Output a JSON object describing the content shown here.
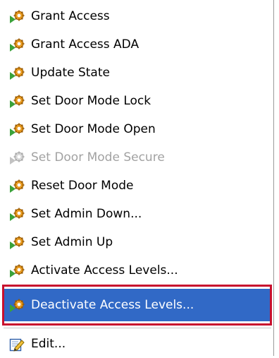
{
  "menu": {
    "items": [
      {
        "label": "Grant Access",
        "state": "normal",
        "icon": "gear-play-icon"
      },
      {
        "label": "Grant Access ADA",
        "state": "normal",
        "icon": "gear-play-icon"
      },
      {
        "label": "Update State",
        "state": "normal",
        "icon": "gear-play-icon"
      },
      {
        "label": "Set Door Mode Lock",
        "state": "normal",
        "icon": "gear-play-icon"
      },
      {
        "label": "Set Door Mode Open",
        "state": "normal",
        "icon": "gear-play-icon"
      },
      {
        "label": "Set Door Mode Secure",
        "state": "disabled",
        "icon": "gear-play-icon"
      },
      {
        "label": "Reset Door Mode",
        "state": "normal",
        "icon": "gear-play-icon"
      },
      {
        "label": "Set Admin Down...",
        "state": "normal",
        "icon": "gear-play-icon"
      },
      {
        "label": "Set Admin Up",
        "state": "normal",
        "icon": "gear-play-icon"
      },
      {
        "label": "Activate Access Levels...",
        "state": "normal",
        "icon": "gear-play-icon"
      },
      {
        "label": "Deactivate Access Levels...",
        "state": "selected",
        "icon": "gear-play-icon"
      },
      {
        "label": "Edit...",
        "state": "normal",
        "icon": "edit-pencil-icon"
      }
    ]
  },
  "colors": {
    "selection": "#3169c6",
    "highlight_box": "#c8102e",
    "disabled_text": "#a2a2a2",
    "gear": "#e79a1f",
    "play_arrow": "#3aa23a"
  }
}
